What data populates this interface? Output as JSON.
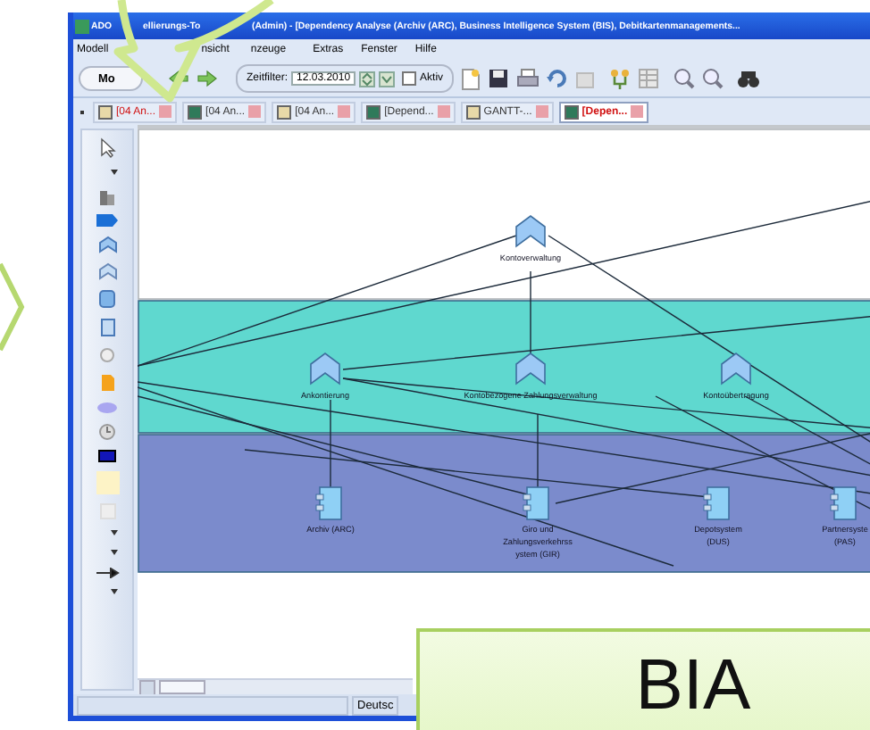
{
  "window": {
    "title_parts": [
      "ADO",
      "ellierungs-To",
      "(Admin) - [Dependency Analyse (Archiv (ARC), Business Intelligence System (BIS), Debitkartenmanagements..."
    ]
  },
  "menu": [
    "Modell",
    "nsicht",
    "nzeuge",
    "Extras",
    "Fenster",
    "Hilfe"
  ],
  "toolbar": {
    "model_button": "Mo",
    "time_filter_label": "Zeitfilter:",
    "date": "12.03.2010",
    "active": {
      "label": "Aktiv",
      "checked": false
    }
  },
  "tabs": [
    {
      "label": "[04 An...",
      "selected": false,
      "highlighted": true
    },
    {
      "label": "[04 An...",
      "selected": false,
      "highlighted": false
    },
    {
      "label": "[04 An...",
      "selected": false,
      "highlighted": false
    },
    {
      "label": "[Depend...",
      "selected": false,
      "highlighted": false
    },
    {
      "label": "GANTT-...",
      "selected": false,
      "highlighted": false
    },
    {
      "label": "[Depen...",
      "selected": true,
      "highlighted": true
    }
  ],
  "diagram": {
    "lanes": [
      {
        "color": "#ffffff",
        "nodes": [
          {
            "kind": "capability",
            "label": [
              "Kontoverwaltung"
            ]
          }
        ]
      },
      {
        "color": "#5fd8cf",
        "nodes": [
          {
            "kind": "capability",
            "label": [
              "Ankontierung"
            ]
          },
          {
            "kind": "capability",
            "label": [
              "Kontobezogene Zahlungsverwaltung"
            ]
          },
          {
            "kind": "capability",
            "label": [
              "Kontoübertragung"
            ]
          }
        ]
      },
      {
        "color": "#7b8bcc",
        "nodes": [
          {
            "kind": "application",
            "label": [
              "Archiv (ARC)"
            ]
          },
          {
            "kind": "application",
            "label": [
              "Giro und",
              "Zahlungsverkehrss",
              "ystem (GIR)"
            ]
          },
          {
            "kind": "application",
            "label": [
              "Depotsystem",
              "(DUS)"
            ]
          },
          {
            "kind": "application",
            "label": [
              "Partnersyste",
              "(PAS)"
            ]
          }
        ]
      }
    ]
  },
  "status_bar": {
    "language": "Deutsc"
  },
  "callout": {
    "text": "BIA"
  }
}
